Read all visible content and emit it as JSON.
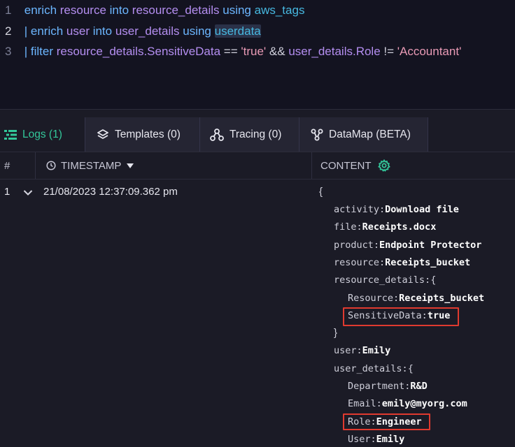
{
  "editor": {
    "lines": [
      {
        "num": "1",
        "tokens": [
          {
            "t": "enrich ",
            "c": "kw"
          },
          {
            "t": "resource ",
            "c": "id"
          },
          {
            "t": "into ",
            "c": "kw"
          },
          {
            "t": "resource_details ",
            "c": "id"
          },
          {
            "t": "using ",
            "c": "kw"
          },
          {
            "t": "aws_tags",
            "c": "fn"
          }
        ]
      },
      {
        "num": "2",
        "tokens": [
          {
            "t": "| ",
            "c": "kw"
          },
          {
            "t": "enrich ",
            "c": "kw"
          },
          {
            "t": "user ",
            "c": "id"
          },
          {
            "t": "into ",
            "c": "kw"
          },
          {
            "t": "user_details ",
            "c": "id"
          },
          {
            "t": "using ",
            "c": "kw"
          },
          {
            "t": "userdata",
            "c": "fn hl"
          }
        ]
      },
      {
        "num": "3",
        "tokens": [
          {
            "t": "| ",
            "c": "kw"
          },
          {
            "t": "filter ",
            "c": "kw"
          },
          {
            "t": "resource_details.SensitiveData ",
            "c": "id"
          },
          {
            "t": "== ",
            "c": "op"
          },
          {
            "t": "'true' ",
            "c": "str"
          },
          {
            "t": "&& ",
            "c": "op"
          },
          {
            "t": "user_details.Role ",
            "c": "id"
          },
          {
            "t": "!= ",
            "c": "op"
          },
          {
            "t": "'Accountant'",
            "c": "str"
          }
        ]
      }
    ]
  },
  "tabs": [
    {
      "label": "Logs (1)",
      "icon": "list-icon"
    },
    {
      "label": "Templates (0)",
      "icon": "layers-icon"
    },
    {
      "label": "Tracing (0)",
      "icon": "tracing-nodes-icon"
    },
    {
      "label": "DataMap (BETA)",
      "icon": "datamap-icon"
    }
  ],
  "table": {
    "headers": {
      "num": "#",
      "timestamp": "TIMESTAMP",
      "content": "CONTENT"
    },
    "rows": [
      {
        "num": "1",
        "timestamp": "21/08/2023 12:37:09.362 pm"
      }
    ]
  },
  "content": {
    "open": "{",
    "fields": [
      {
        "k": "activity",
        "v": "Download file"
      },
      {
        "k": "file",
        "v": "Receipts.docx"
      },
      {
        "k": "product",
        "v": "Endpoint Protector"
      },
      {
        "k": "resource",
        "v": "Receipts_bucket"
      },
      {
        "k": "resource_details",
        "v": "{"
      },
      {
        "k": "Resource",
        "v": "Receipts_bucket"
      },
      {
        "k": "SensitiveData",
        "v": "true"
      },
      {
        "close": "}"
      },
      {
        "k": "user",
        "v": "Emily"
      },
      {
        "k": "user_details",
        "v": "{"
      },
      {
        "k": "Department",
        "v": "R&D"
      },
      {
        "k": "Email",
        "v": "emily@myorg.com"
      },
      {
        "k": "Role",
        "v": "Engineer"
      },
      {
        "k": "User",
        "v": "Emily"
      }
    ]
  },
  "colors": {
    "accent": "#33c79a",
    "highlight_box": "#e03a2f"
  }
}
